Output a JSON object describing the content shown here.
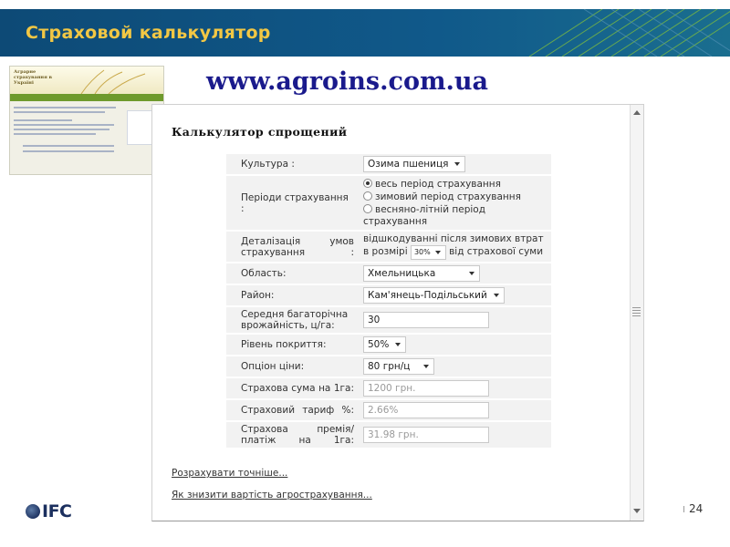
{
  "header": {
    "title": "Страховой калькулятор"
  },
  "thumbnail": {
    "logo_text": "Аграрне страхування в Україні"
  },
  "site_url": "www.agroins.com.ua",
  "calculator": {
    "title": "Калькулятор спрощений",
    "fields": {
      "culture": {
        "label": "Культура :",
        "value": "Озима пшениця"
      },
      "periods": {
        "label": "Періоди страхування :",
        "options": [
          {
            "label": "весь період страхування",
            "checked": true
          },
          {
            "label": "зимовий період страхування",
            "checked": false
          },
          {
            "label": "весняно-літній період страхування",
            "checked": false
          }
        ]
      },
      "detail": {
        "label": "Деталізація умов страхування :",
        "text_before": "відшкодуванні після зимових втрат в розмірі",
        "percent": "30%",
        "text_after": "від страхової суми"
      },
      "region": {
        "label": "Область:",
        "value": "Хмельницька"
      },
      "district": {
        "label": "Район:",
        "value": "Кам'янець-Подільський"
      },
      "yield": {
        "label": "Середня багаторічна врожайність, ц/га:",
        "value": "30"
      },
      "coverage": {
        "label": "Рівень покриття:",
        "value": "50%"
      },
      "price": {
        "label": "Опціон ціни:",
        "value": "80 грн/ц"
      },
      "sum_insured": {
        "label": "Страхова сума на 1га:",
        "value": "1200 грн."
      },
      "tariff": {
        "label": "Страховий тариф %:",
        "value": "2.66%"
      },
      "premium": {
        "label": "Страхова премія/платіж на 1га:",
        "value": "31.98 грн."
      }
    },
    "links": {
      "calculate_precise": "Розрахувати точніше...",
      "reduce_cost": "Як знизити вартість агрострахування..."
    }
  },
  "footer": {
    "logo": "IFC",
    "separator": "I",
    "page_number": "24"
  },
  "colors": {
    "header_bg": "#10598a",
    "header_title": "#f2c744",
    "url": "#1a1a8c",
    "row_bg": "#f2f2f2"
  }
}
